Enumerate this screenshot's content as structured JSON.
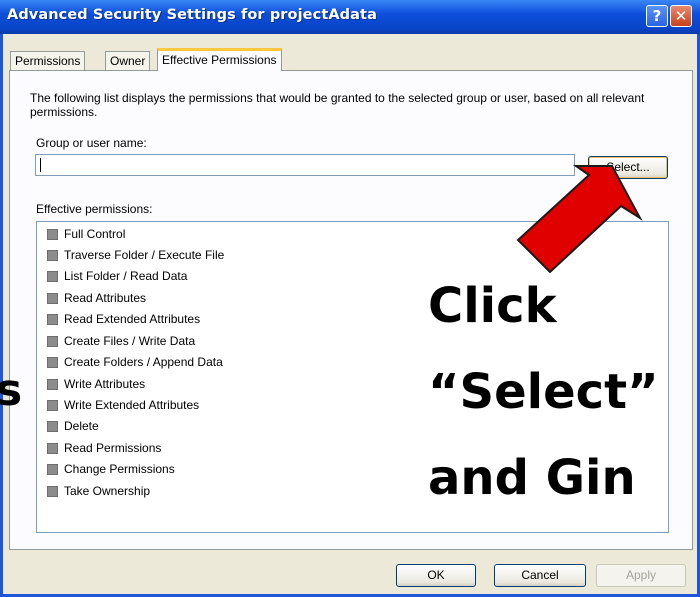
{
  "window": {
    "title": "Advanced Security Settings for projectAdata",
    "help_glyph": "?",
    "close_glyph": "✕"
  },
  "tabs": [
    {
      "label": "Permissions",
      "active": false
    },
    {
      "label": "Owner",
      "active": false
    },
    {
      "label": "Effective Permissions",
      "active": true
    }
  ],
  "panel": {
    "description": "The following list displays the permissions that would be granted to the selected group or user, based on all relevant permissions.",
    "group_label": "Group or user name:",
    "group_value": "",
    "select_button": "Select...",
    "effective_label": "Effective permissions:",
    "permissions": [
      {
        "label": "Full Control",
        "checked": true
      },
      {
        "label": "Traverse Folder / Execute File",
        "checked": true
      },
      {
        "label": "List Folder / Read Data",
        "checked": true
      },
      {
        "label": "Read Attributes",
        "checked": true
      },
      {
        "label": "Read Extended Attributes",
        "checked": true
      },
      {
        "label": "Create Files / Write Data",
        "checked": true
      },
      {
        "label": "Create Folders / Append Data",
        "checked": true
      },
      {
        "label": "Write Attributes",
        "checked": true
      },
      {
        "label": "Write Extended Attributes",
        "checked": true
      },
      {
        "label": "Delete",
        "checked": true
      },
      {
        "label": "Read Permissions",
        "checked": true
      },
      {
        "label": "Change Permissions",
        "checked": true
      },
      {
        "label": "Take Ownership",
        "checked": true
      }
    ]
  },
  "footer": {
    "ok": "OK",
    "cancel": "Cancel",
    "apply": "Apply"
  },
  "overlay": {
    "lines": [
      "Click",
      "“Select”",
      "and Gin"
    ],
    "left_fragment": "s",
    "arrow_color": "#e00000"
  }
}
